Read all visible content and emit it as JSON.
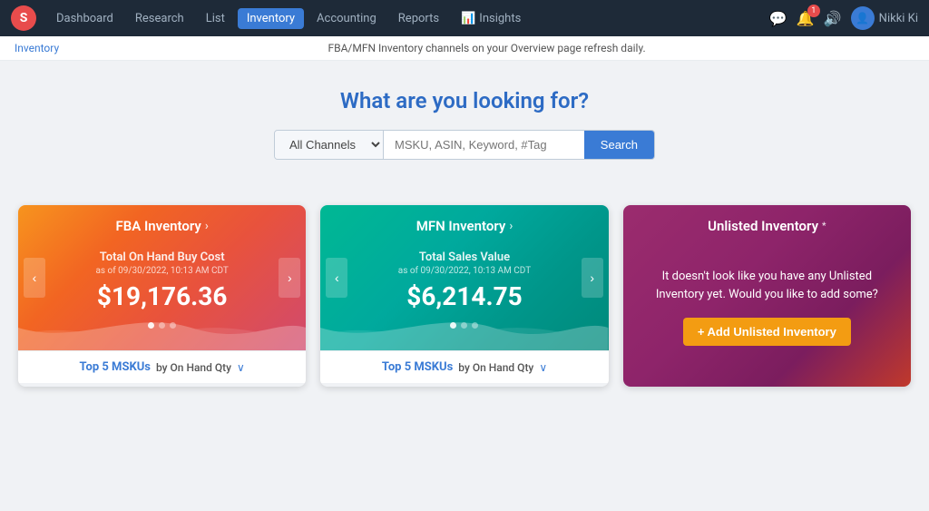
{
  "navbar": {
    "logo": "S",
    "items": [
      {
        "id": "dashboard",
        "label": "Dashboard",
        "active": false
      },
      {
        "id": "research",
        "label": "Research",
        "active": false
      },
      {
        "id": "list",
        "label": "List",
        "active": false
      },
      {
        "id": "inventory",
        "label": "Inventory",
        "active": true
      },
      {
        "id": "accounting",
        "label": "Accounting",
        "active": false
      },
      {
        "id": "reports",
        "label": "Reports",
        "active": false
      },
      {
        "id": "insights",
        "label": "Insights",
        "active": false
      }
    ],
    "user_label": "Nikki Ki"
  },
  "subheader": {
    "breadcrumb": "Inventory",
    "notice": "FBA/MFN Inventory channels on your Overview page refresh daily."
  },
  "search": {
    "heading": "What are you looking for?",
    "channel_default": "All Channels",
    "input_placeholder": "MSKU, ASIN, Keyword, #Tag",
    "button_label": "Search"
  },
  "cards": {
    "fba": {
      "title": "FBA Inventory",
      "metric_label": "Total On Hand Buy Cost",
      "metric_date": "as of 09/30/2022, 10:13 AM CDT",
      "metric_value": "$19,176.36",
      "dots": [
        true,
        false,
        false
      ],
      "bottom_label": "Top 5 MSKUs",
      "bottom_sub": "by On Hand Qty"
    },
    "mfn": {
      "title": "MFN Inventory",
      "metric_label": "Total Sales Value",
      "metric_date": "as of 09/30/2022, 10:13 AM CDT",
      "metric_value": "$6,214.75",
      "dots": [
        true,
        false,
        false
      ],
      "bottom_label": "Top 5 MSKUs",
      "bottom_sub": "by On Hand Qty"
    },
    "unlisted": {
      "title": "Unlisted Inventory",
      "title_superscript": "*",
      "description": "It doesn't look like you have any Unlisted Inventory yet. Would you like to add some?",
      "add_button": "+ Add Unlisted Inventory"
    }
  },
  "icons": {
    "chevron_right": "›",
    "chevron_left": "‹",
    "chevron_down": "∨",
    "chat": "💬",
    "bell": "🔔",
    "volume": "🔊",
    "user": "👤",
    "badge_count": "1"
  }
}
